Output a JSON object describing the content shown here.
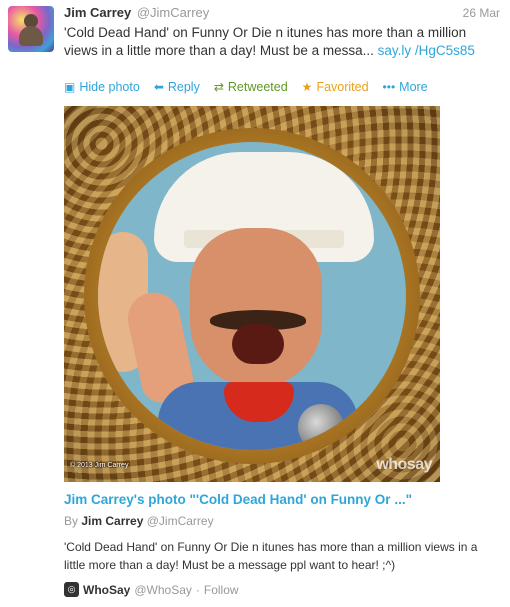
{
  "tweet": {
    "name": "Jim Carrey",
    "handle": "@JimCarrey",
    "date": "26 Mar",
    "text": "'Cold Dead Hand' on Funny Or Die n itunes has more than a million views in a little more than a day! Must be a messa...",
    "link": "say.ly /HgC5s85"
  },
  "actions": {
    "hide_photo": "Hide photo",
    "reply": "Reply",
    "retweeted": "Retweeted",
    "favorited": "Favorited",
    "more": "More"
  },
  "photo": {
    "copyright": "© 2013 Jim Carrey",
    "watermark": "whosay"
  },
  "card": {
    "title": "Jim Carrey's photo \"'Cold Dead Hand' on Funny Or ...\"",
    "by_prefix": "By",
    "by_name": "Jim Carrey",
    "by_handle": "@JimCarrey",
    "description": "'Cold Dead Hand' on Funny Or Die n itunes has more than a million views in a little more than a day! Must be a message ppl want to hear! ;^)"
  },
  "source": {
    "name": "WhoSay",
    "handle": "@WhoSay",
    "separator": "·",
    "follow": "Follow"
  },
  "colors": {
    "link": "#2fa6d9",
    "retweet": "#609928",
    "favorite": "#e8a21a"
  }
}
